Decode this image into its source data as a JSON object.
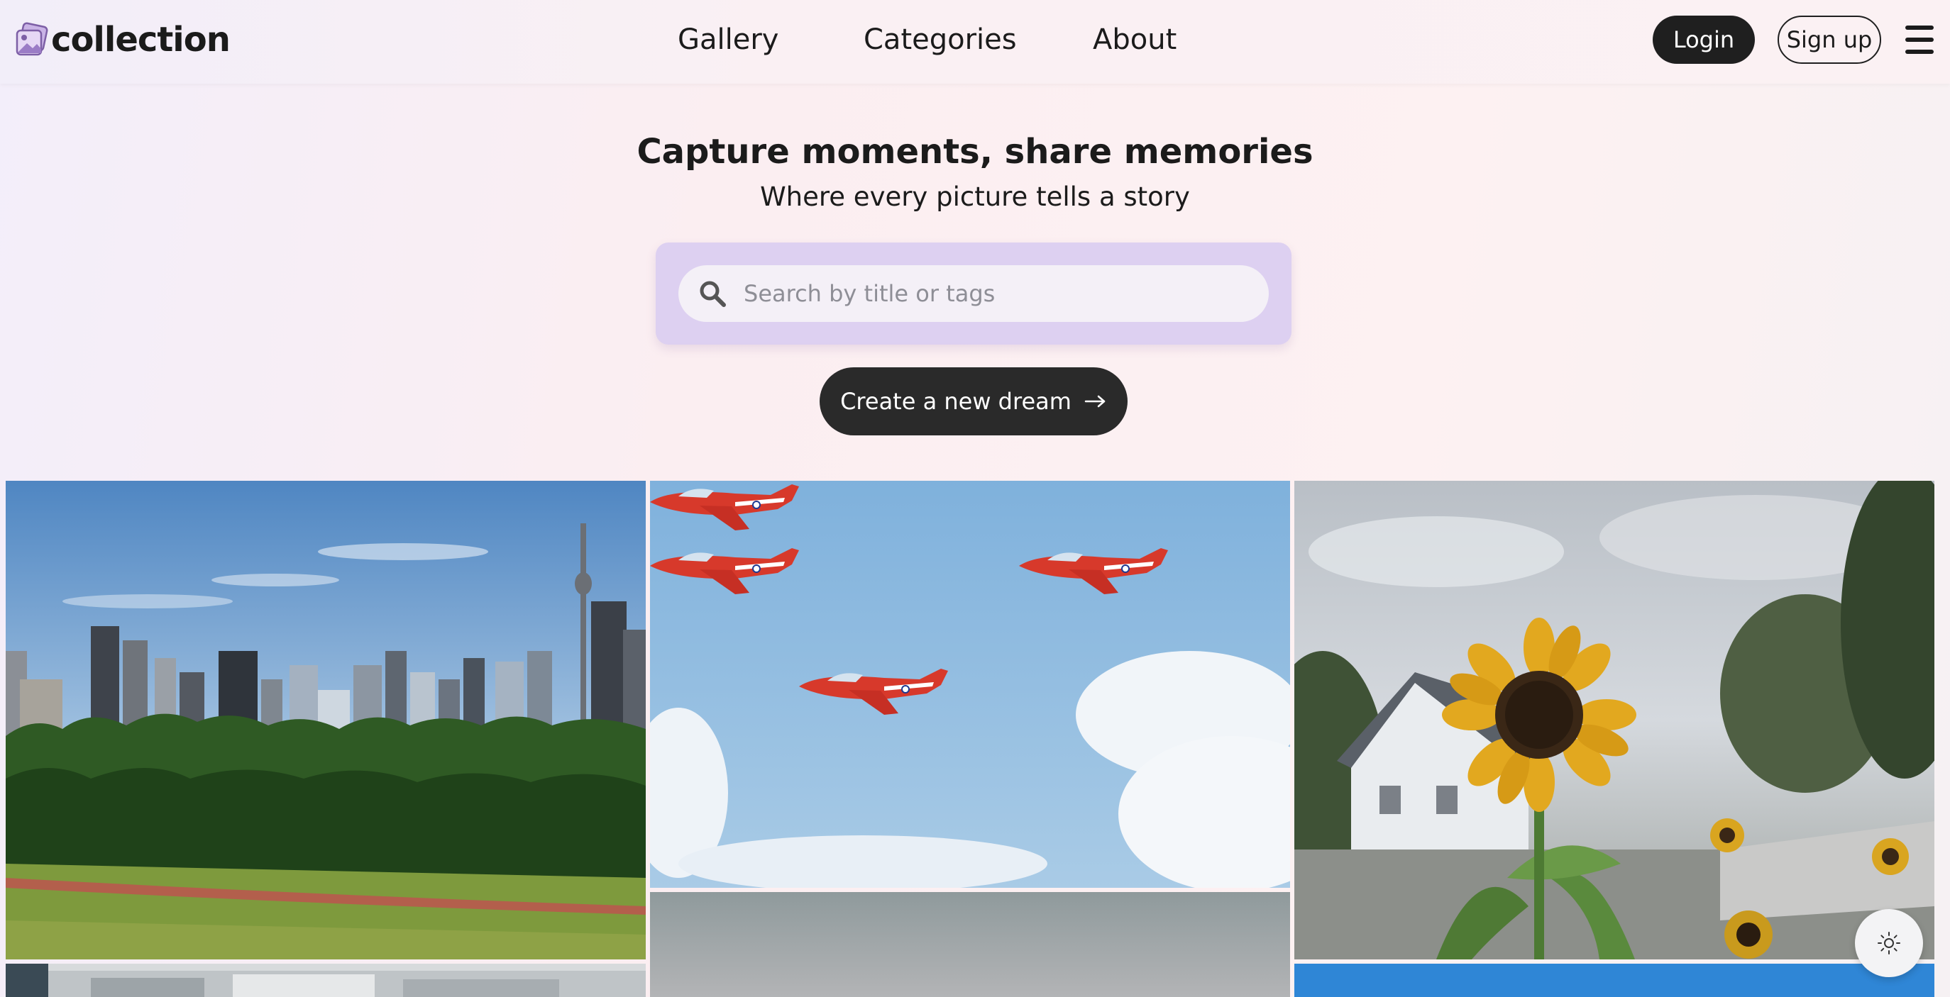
{
  "header": {
    "logo_text": "collection",
    "nav": {
      "gallery": "Gallery",
      "categories": "Categories",
      "about": "About"
    },
    "login_label": "Login",
    "signup_label": "Sign up",
    "menu_icon": "hamburger-menu-icon"
  },
  "hero": {
    "title": "Capture moments, share memories",
    "subtitle": "Where every picture tells a story",
    "search": {
      "placeholder": "Search by title or tags",
      "value": "",
      "icon": "search-icon"
    },
    "cta_label": "Create a new dream",
    "cta_icon": "arrow-right-icon"
  },
  "gallery": {
    "tiles": [
      "city-skyline-park",
      "red-jets-formation",
      "sunflower-garden",
      "building-rooftop",
      "hazy-sky",
      "blue-sky"
    ]
  },
  "theme_toggle_icon": "sun-icon",
  "colors": {
    "dark_button": "#1f1f1f",
    "search_panel": "#ddd0f1",
    "search_box": "#f4f0f7"
  }
}
